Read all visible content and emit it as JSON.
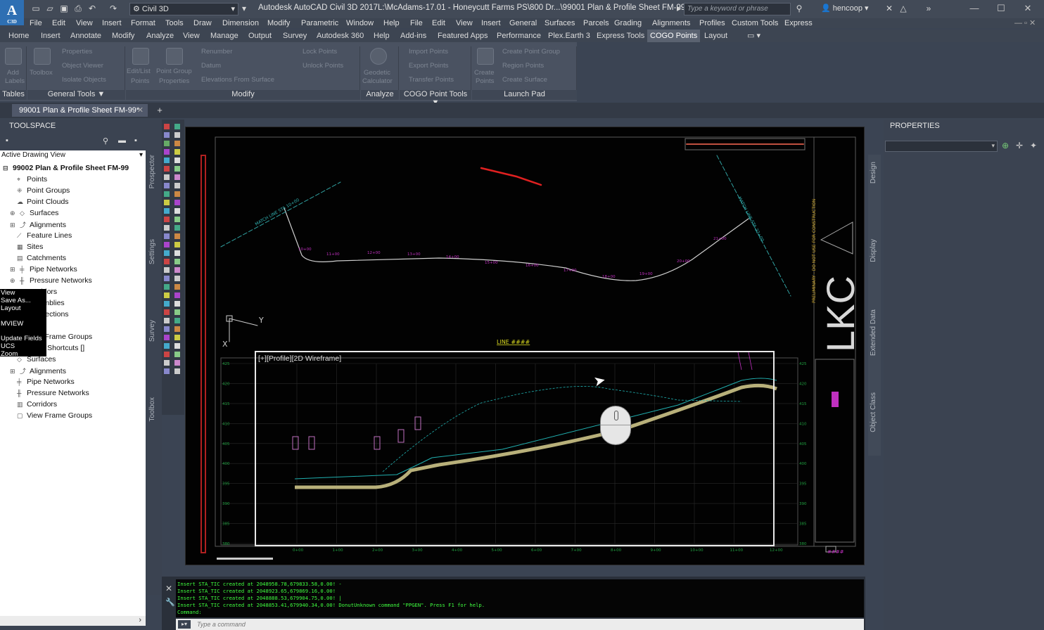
{
  "app": {
    "logo_text": "A",
    "logo_sub": "C3D",
    "workspace": "Civil 3D",
    "app_title": "Autodesk AutoCAD Civil 3D 2017",
    "file_title": "L:\\McAdams-17.01 - Honeycutt Farms PS\\800 Dr...\\99001 Plan & Profile Sheet FM-99.dwg",
    "search_placeholder": "Type a keyword or phrase",
    "user": "hencoop"
  },
  "menubar": [
    "File",
    "Edit",
    "View",
    "Insert",
    "Format",
    "Tools",
    "Draw",
    "Dimension",
    "Modify",
    "Parametric",
    "Window",
    "Help",
    "File",
    "Edit",
    "View",
    "Insert",
    "General",
    "Surfaces",
    "Parcels",
    "Grading",
    "Alignments",
    "Profiles",
    "Custom Tools",
    "Express"
  ],
  "ribbon_tabs": [
    "Home",
    "Insert",
    "Annotate",
    "Modify",
    "Analyze",
    "View",
    "Manage",
    "Output",
    "Survey",
    "Autodesk 360",
    "Help",
    "Add-ins",
    "Featured Apps",
    "Performance",
    "Plex.Earth 3",
    "Express Tools",
    "COGO Points",
    "Layout"
  ],
  "ribbon_active_tab": "COGO Points",
  "ribbon_panels": [
    "Tables",
    "General Tools ▼",
    "Modify",
    "Analyze",
    "COGO Point Tools ▼",
    "Launch Pad"
  ],
  "ribbon_ghost": {
    "tables": [
      "Add",
      "Labels"
    ],
    "general": [
      "Properties",
      "Object Viewer",
      "Isolate Objects",
      "Toolbox"
    ],
    "modify": [
      "Edit/List",
      "Points",
      "Point Group",
      "Properties",
      "Renumber",
      "Datum",
      "Elevations From Surface"
    ],
    "modify2": [
      "Lock Points",
      "Unlock Points"
    ],
    "analyze": [
      "Geodetic",
      "Calculator"
    ],
    "cogo": [
      "Import Points",
      "Export Points",
      "Transfer Points"
    ],
    "launch": [
      "Create Point Group",
      "Create",
      "Points",
      "Region Points",
      "Create Surface"
    ]
  },
  "doc_tab": "99001 Plan & Profile Sheet FM-99*",
  "toolspace": {
    "title": "TOOLSPACE",
    "view": "Active Drawing View",
    "root": "99002 Plan & Profile Sheet FM-99",
    "items": [
      "Points",
      "Point Groups",
      "Point Clouds",
      "Surfaces",
      "Alignments",
      "Feature Lines",
      "Sites",
      "Catchments",
      "Pipe Networks",
      "Pressure Networks",
      "Corridors",
      "Assemblies",
      "Intersections",
      "",
      "View Frame Groups",
      "Data Shortcuts []",
      "Surfaces",
      "Alignments",
      "Pipe Networks",
      "Pressure Networks",
      "Corridors",
      "View Frame Groups"
    ],
    "side_tabs": [
      "Prospector",
      "Settings",
      "Survey",
      "Toolbox"
    ]
  },
  "context_menu": [
    "View",
    "Save As...",
    "Layout",
    "MVIEW",
    "Update Fields",
    "UCS",
    "Zoom"
  ],
  "drawing": {
    "viewport_label": "[+][Profile][2D Wireframe]",
    "match_left": "MATCH LINE STA 10+00",
    "match_right": "MATCH LINE STA 22+00",
    "line_tag": "LINE ####",
    "brand": "LKC",
    "prelim": "PRELIMINARY - DO NOT USE FOR CONSTRUCTION",
    "stations_plan": [
      "10+00",
      "11+00",
      "12+00",
      "13+00",
      "14+00",
      "15+00",
      "16+00",
      "17+00",
      "18+00",
      "19+00",
      "20+00",
      "21+00"
    ],
    "profile_elev_left": [
      "425",
      "420",
      "415",
      "410",
      "405",
      "400",
      "395",
      "390",
      "385",
      "380"
    ],
    "profile_elev_right": [
      "425",
      "420",
      "415",
      "410",
      "405",
      "400",
      "395",
      "390",
      "385",
      "380"
    ],
    "profile_stations": [
      "0+00",
      "1+00",
      "2+00",
      "3+00",
      "4+00",
      "5+00",
      "6+00",
      "7+00",
      "8+00",
      "9+00",
      "10+00",
      "11+00",
      "12+00"
    ],
    "sheet_no": "####",
    "ucs_y": "Y",
    "ucs_x": "X"
  },
  "command": {
    "history": [
      "Insert STA_TIC created at 2048958.78,679833.58,0.00! -",
      "Insert STA_TIC created at 2048923.65,679869.16,0.00!",
      "Insert STA_TIC created at 2048888.53,679904.75,0.00! |",
      "Insert STA_TIC created at 2048853.41,679940.34,0.00!   DonutUnknown command \"PPGEN\".  Press F1 for help.",
      "Command:"
    ],
    "placeholder": "Type a command"
  },
  "properties": {
    "title": "PROPERTIES",
    "tabs": [
      "Design",
      "Display",
      "Extended Data",
      "Object Class"
    ]
  },
  "colors": {
    "accent": "#2e6fb3",
    "ribbon": "#4a5261",
    "chrome": "#3b4351",
    "cmd_text": "#40ff40"
  }
}
